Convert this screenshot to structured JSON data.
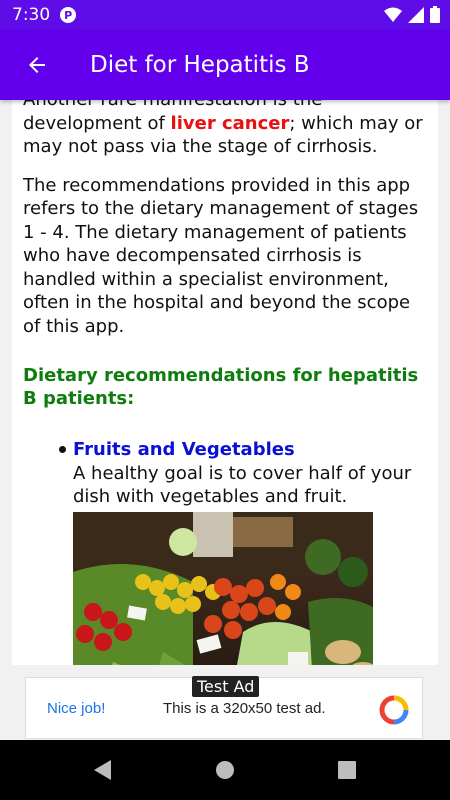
{
  "status_bar": {
    "time": "7:30",
    "app_icon": "P"
  },
  "app_bar": {
    "title": "Diet for Hepatitis B"
  },
  "article": {
    "p1_before": "Another rare manifestation is the development of ",
    "p1_highlight": "liver cancer",
    "p1_after": "; which may or may not pass via the stage of cirrhosis.",
    "p2": "The recommendations provided in this app refers to the dietary management of stages 1 - 4. The dietary management of patients who have decompensated cirrhosis is handled within a specialist environment, often in the hospital and beyond the scope of this app.",
    "heading": "Dietary recommendations for hepatitis B patients:",
    "bullet_title": "Fruits and Vegetables",
    "bullet_text": "A healthy goal is to cover half of your dish with vegetables and fruit."
  },
  "ad": {
    "tag": "Test Ad",
    "nice": "Nice job!",
    "text": "This is a 320x50 test ad."
  },
  "colors": {
    "status_bar": "#5f0de8",
    "app_bar": "#6200ee",
    "highlight_red": "#e81010",
    "heading_green": "#0f7c0f",
    "bullet_blue": "#0a10d4"
  }
}
